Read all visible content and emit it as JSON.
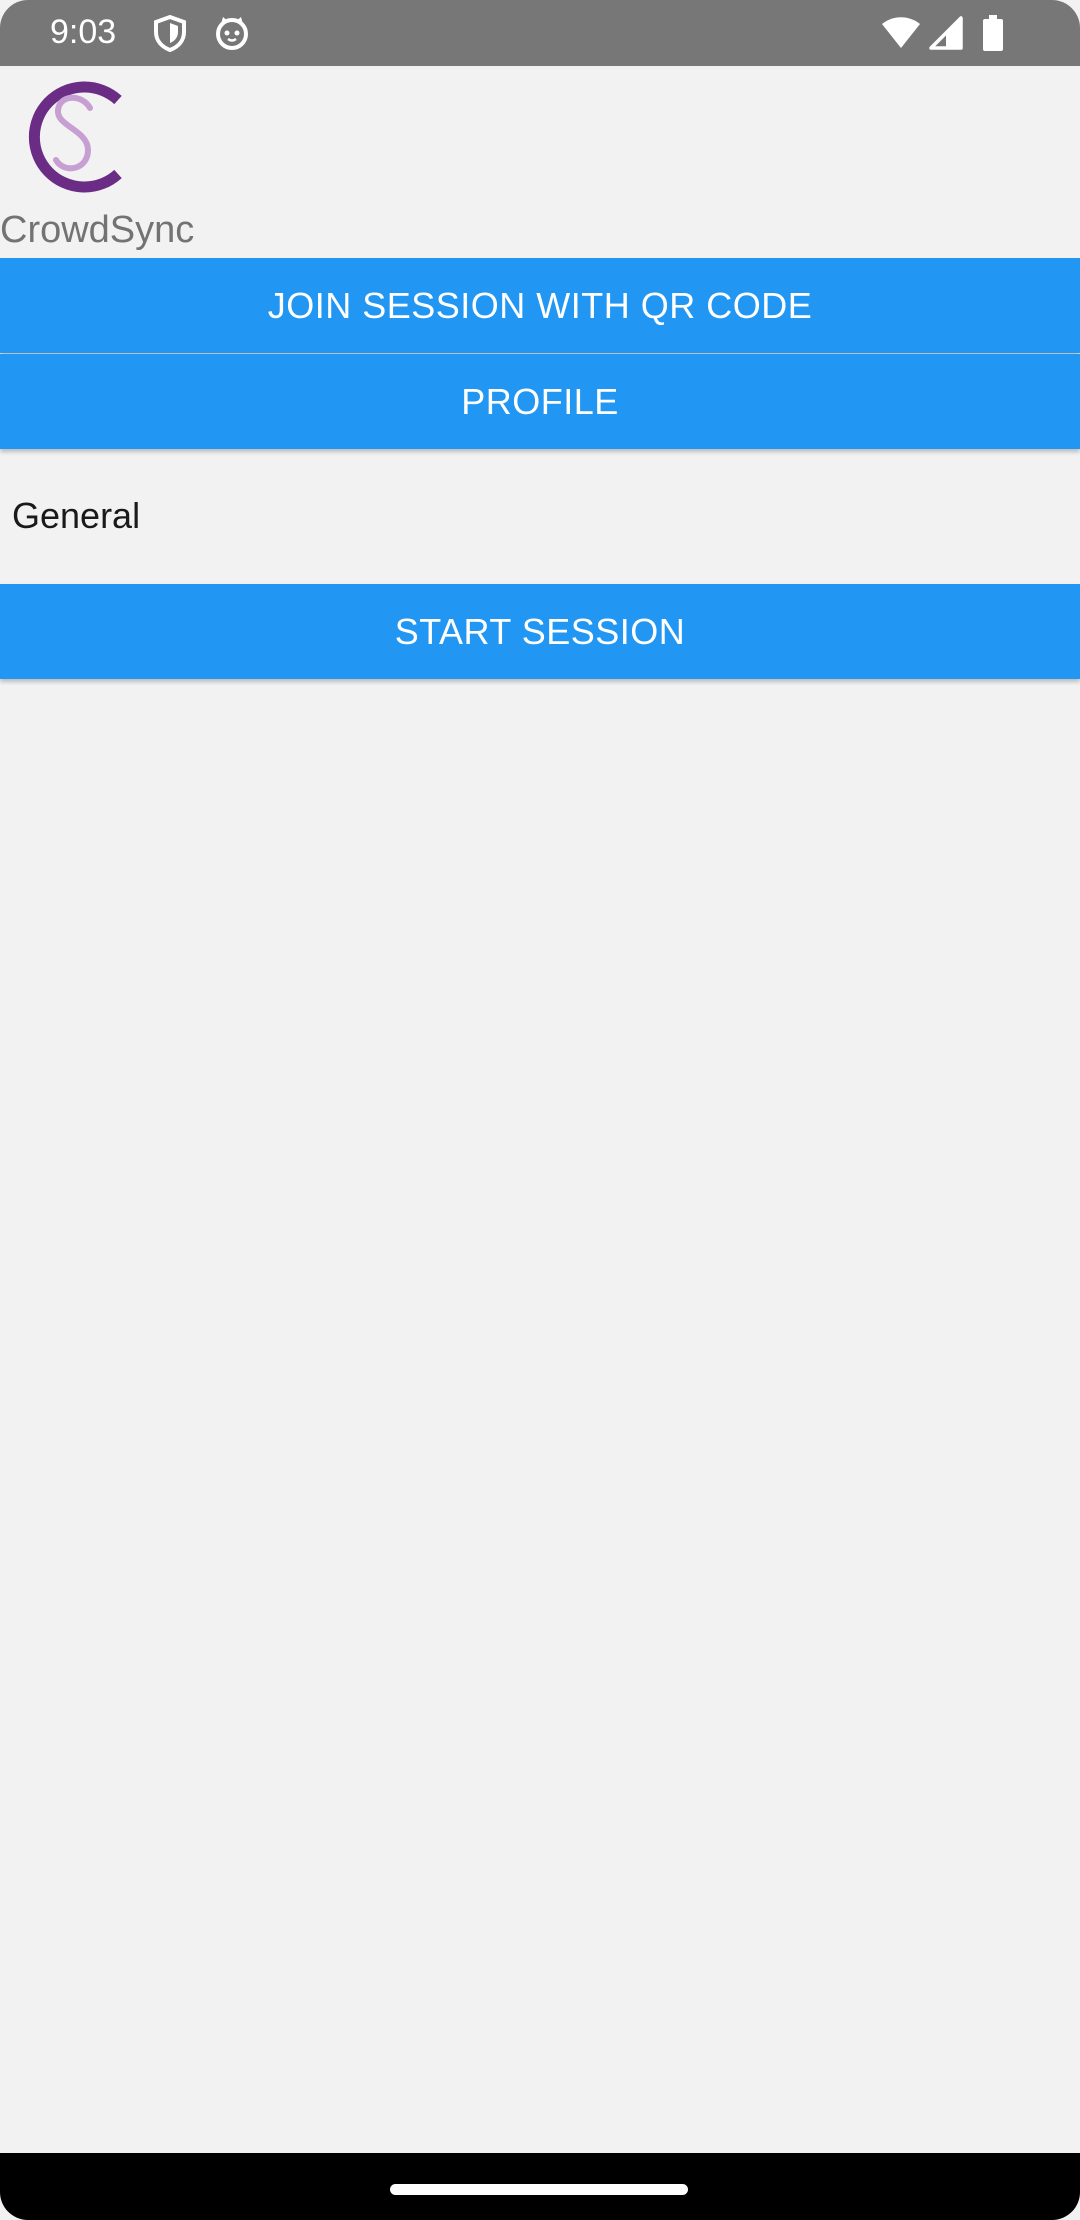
{
  "status_bar": {
    "time": "9:03",
    "icons": [
      "shield-icon",
      "cat-face-icon",
      "wifi-icon",
      "signal-icon",
      "battery-icon"
    ]
  },
  "app": {
    "name": "CrowdSync",
    "logo": "crowdsync-logo",
    "brand_colors": {
      "primary_purple": "#6a2c85",
      "secondary_lilac": "#c79fd3"
    }
  },
  "actions": {
    "join_label": "JOIN SESSION WITH QR CODE",
    "profile_label": "PROFILE",
    "start_label": "START SESSION"
  },
  "session": {
    "category": "General"
  },
  "colors": {
    "button_blue": "#2196f3",
    "background": "#f2f2f2",
    "status_bar": "#777777"
  }
}
